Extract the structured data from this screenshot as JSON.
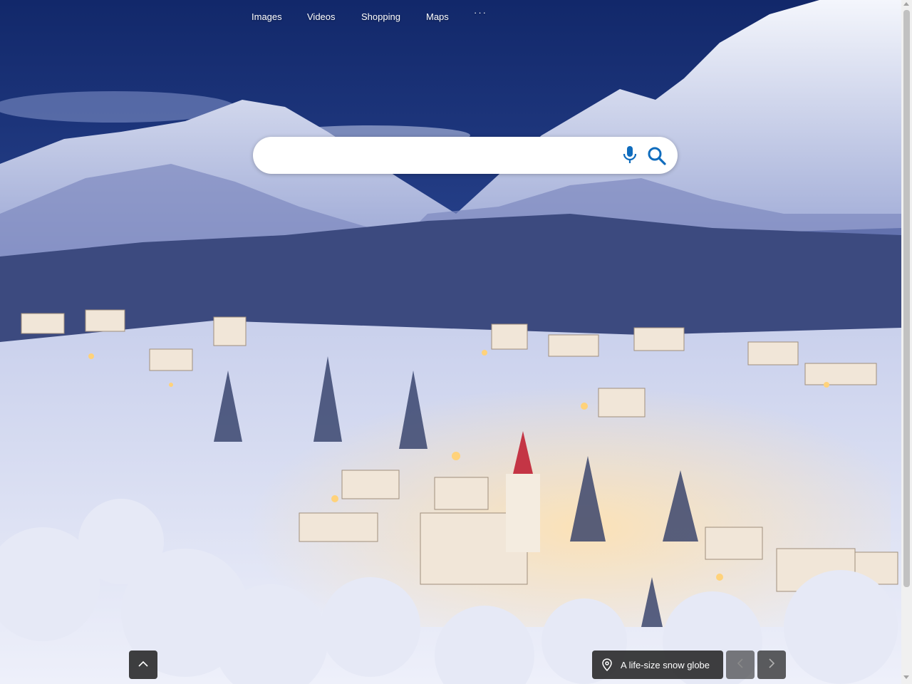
{
  "nav": {
    "items": [
      "Images",
      "Videos",
      "Shopping",
      "Maps"
    ],
    "more_label": "···"
  },
  "search": {
    "value": "",
    "placeholder": ""
  },
  "caption": {
    "text": "A life-size snow globe"
  },
  "icons": {
    "mic": "microphone-icon",
    "search": "search-icon",
    "scroll_up": "chevron-up-icon",
    "location": "location-pin-icon",
    "prev": "chevron-left-icon",
    "next": "chevron-right-icon"
  },
  "colors": {
    "accent": "#0078d4",
    "sky": "#1b2f6b",
    "snow": "#e8ecf7"
  }
}
